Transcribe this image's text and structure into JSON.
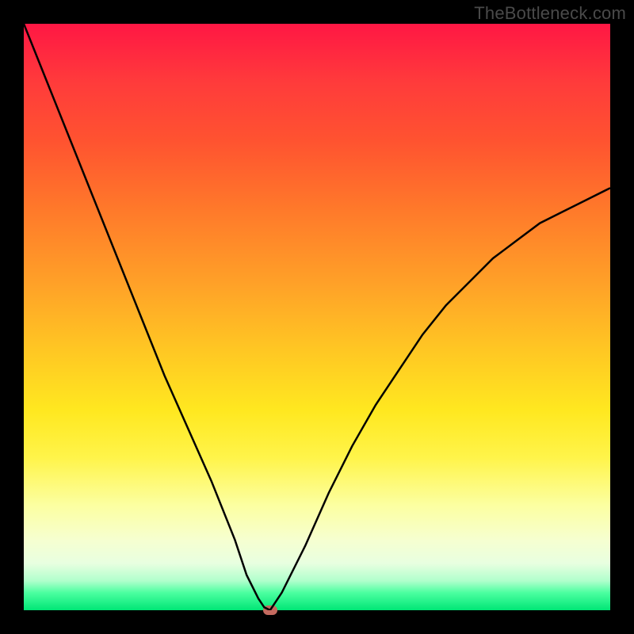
{
  "watermark": "TheBottleneck.com",
  "colors": {
    "frame": "#000000",
    "curve_stroke": "#000000",
    "marker_fill": "#c46a5f",
    "gradient_top": "#ff1744",
    "gradient_bottom": "#00e676"
  },
  "chart_data": {
    "type": "line",
    "title": "",
    "xlabel": "",
    "ylabel": "",
    "xlim": [
      0,
      100
    ],
    "ylim": [
      0,
      100
    ],
    "grid": false,
    "x": [
      0,
      4,
      8,
      12,
      16,
      20,
      24,
      28,
      32,
      36,
      38,
      40,
      41,
      42,
      44,
      48,
      52,
      56,
      60,
      64,
      68,
      72,
      76,
      80,
      84,
      88,
      92,
      96,
      100
    ],
    "values": [
      100,
      90,
      80,
      70,
      60,
      50,
      40,
      31,
      22,
      12,
      6,
      2,
      0.5,
      0,
      3,
      11,
      20,
      28,
      35,
      41,
      47,
      52,
      56,
      60,
      63,
      66,
      68,
      70,
      72
    ],
    "marker": {
      "x": 42,
      "y": 0
    },
    "notes": "x and y in percent of plotting area; y=0 is bottom, y=100 is top. Curve descends steeply from top-left to a minimum near x≈42 then rises asymptotically toward ~72 at right edge."
  }
}
